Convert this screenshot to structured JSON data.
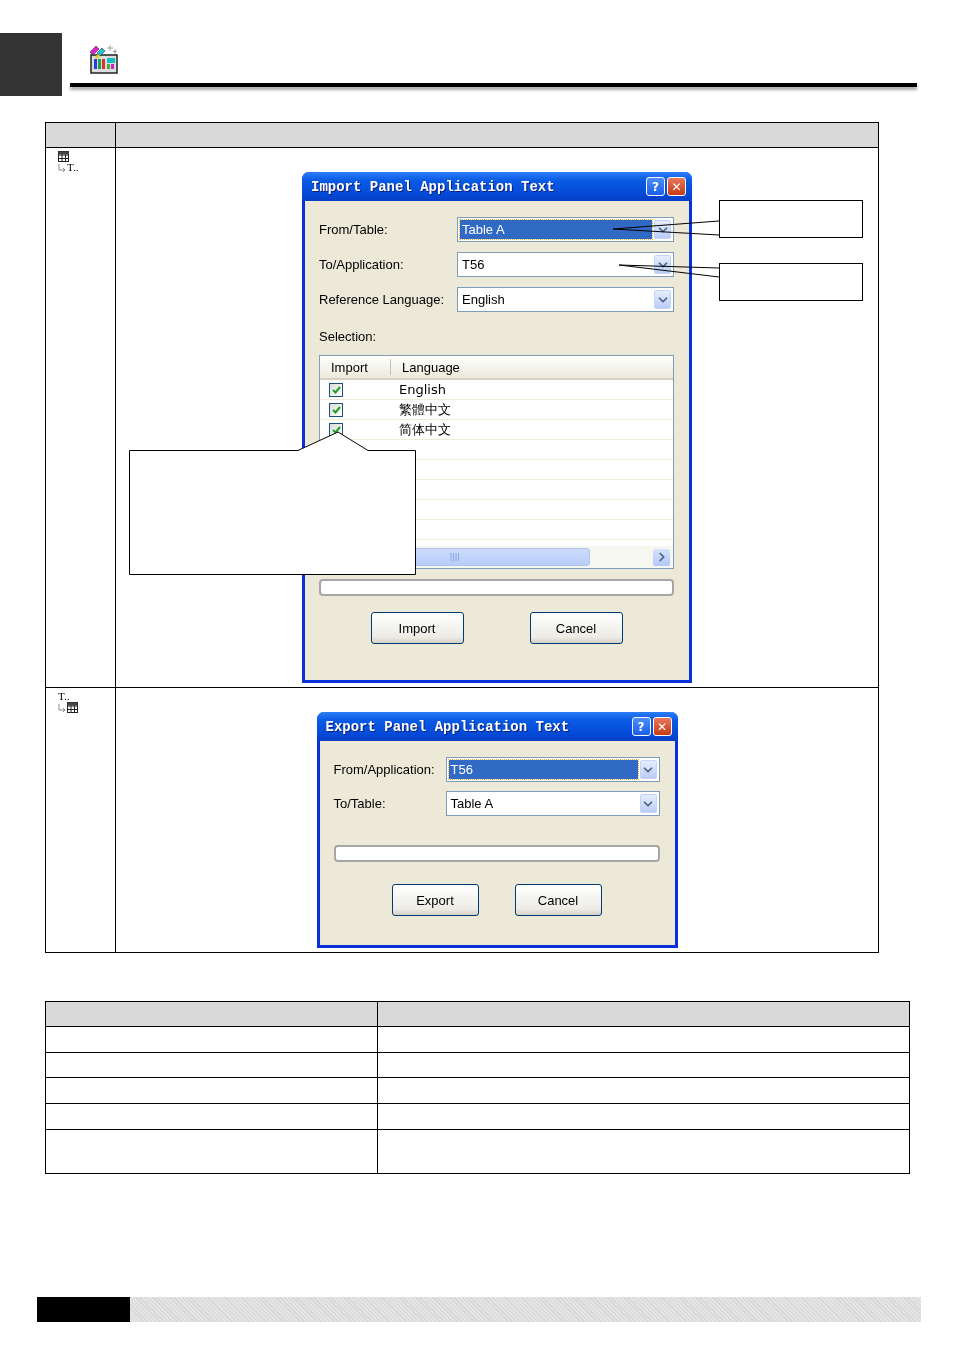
{
  "feature_table": {
    "rows": [
      {
        "kind": "import",
        "icon_caption": "T..",
        "dialog": {
          "title": "Import Panel Application Text",
          "title_buttons": [
            {
              "kind": "help",
              "glyph": "?"
            },
            {
              "kind": "close",
              "glyph": "✕"
            }
          ],
          "fields": [
            {
              "label": "From/Table:",
              "value": "Table  A",
              "selected": true
            },
            {
              "label": "To/Application:",
              "value": "T56",
              "selected": false
            },
            {
              "label": "Reference Language:",
              "value": "English",
              "selected": false
            }
          ],
          "selection_label": "Selection:",
          "language_list": {
            "columns": [
              "Import",
              "Language"
            ],
            "rows": [
              {
                "checked": true,
                "language": "English"
              },
              {
                "checked": true,
                "language": "繁體中文"
              },
              {
                "checked": true,
                "language": "简体中文"
              }
            ]
          },
          "buttons": [
            "Import",
            "Cancel"
          ]
        }
      },
      {
        "kind": "export",
        "icon_caption": "T..",
        "dialog": {
          "title": "Export Panel Application Text",
          "title_buttons": [
            {
              "kind": "help",
              "glyph": "?"
            },
            {
              "kind": "close",
              "glyph": "✕"
            }
          ],
          "fields": [
            {
              "label": "From/Application:",
              "value": "T56",
              "selected": true
            },
            {
              "label": "To/Table:",
              "value": "Table  A",
              "selected": false
            }
          ],
          "buttons": [
            "Export",
            "Cancel"
          ]
        }
      }
    ]
  }
}
